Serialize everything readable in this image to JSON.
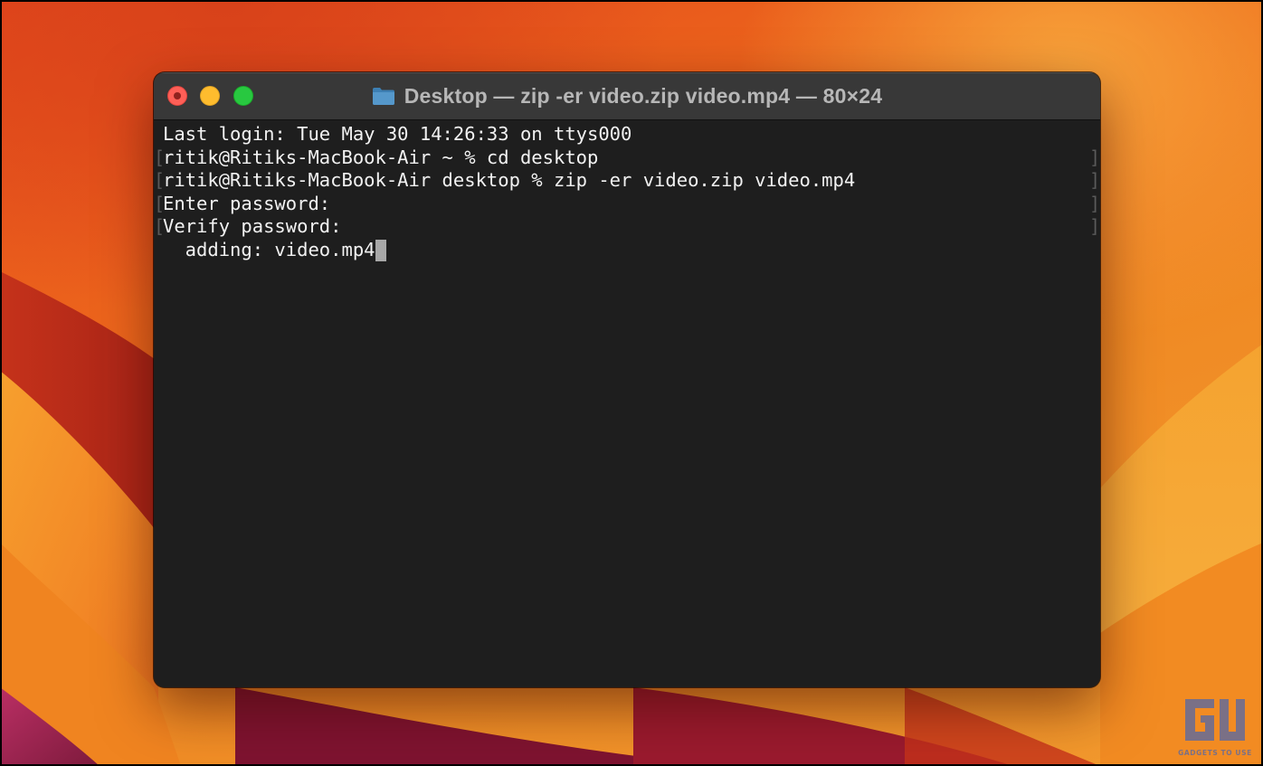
{
  "window": {
    "title": "Desktop — zip -er video.zip video.mp4 — 80×24",
    "title_icon": "folder-icon",
    "controls": {
      "close": "close-button",
      "minimize": "minimize-button",
      "zoom": "zoom-button"
    }
  },
  "terminal": {
    "lines": [
      "Last login: Tue May 30 14:26:33 on ttys000",
      "ritik@Ritiks-MacBook-Air ~ % cd desktop",
      "ritik@Ritiks-MacBook-Air desktop % zip -er video.zip video.mp4",
      "Enter password:",
      "Verify password:",
      "  adding: video.mp4"
    ]
  },
  "watermark": {
    "logo_text": "GU",
    "caption": "GADGETS TO USE"
  },
  "colors": {
    "terminal_background": "#1e1e1e",
    "titlebar": "#383838",
    "text": "#f2f2f2",
    "close": "#fe5f57",
    "minimize": "#febc2e",
    "zoom": "#28c840",
    "wallpaper_accent": "#e8641a"
  }
}
